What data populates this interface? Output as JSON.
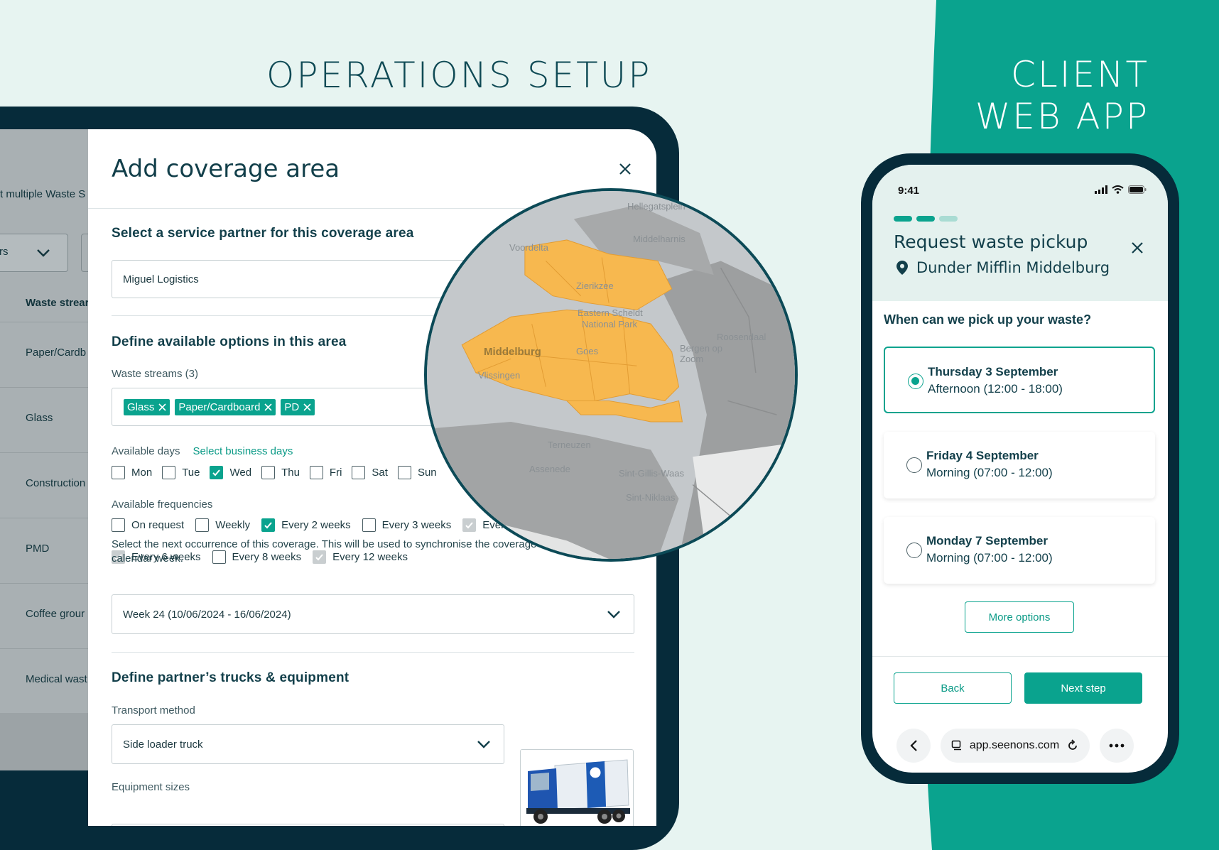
{
  "colors": {
    "accent": "#0aa38e",
    "dark": "#062b3a",
    "mint_bg": "#e7f4f1",
    "map_area": "#f7b84f"
  },
  "headings": {
    "operations": "OPERATIONS SETUP",
    "client_line1": "CLIENT",
    "client_line2": "WEB APP"
  },
  "backdrop": {
    "partial_text": "t multiple Waste S",
    "select_partial": "rs",
    "column_header": "Waste strear",
    "rows": [
      "Paper/Cardb",
      "Glass",
      "Construction",
      "PMD",
      "Coffee grour",
      "Medical wast"
    ]
  },
  "modal": {
    "title": "Add coverage area",
    "partner_section": "Select a service partner for this coverage area",
    "partner_value": "Miguel Logistics",
    "options_section": "Define available options in this area",
    "waste_label": "Waste streams (3)",
    "waste_tags": [
      "Glass",
      "Paper/Cardboard",
      "PD"
    ],
    "days_label": "Available days",
    "days_link": "Select business days",
    "days": [
      {
        "label": "Mon",
        "state": "off"
      },
      {
        "label": "Tue",
        "state": "off"
      },
      {
        "label": "Wed",
        "state": "on"
      },
      {
        "label": "Thu",
        "state": "off"
      },
      {
        "label": "Fri",
        "state": "off"
      },
      {
        "label": "Sat",
        "state": "off"
      },
      {
        "label": "Sun",
        "state": "off"
      }
    ],
    "freq_label": "Available frequencies",
    "freq_row1": [
      {
        "label": "On request",
        "state": "off"
      },
      {
        "label": "Weekly",
        "state": "off"
      },
      {
        "label": "Every 2 weeks",
        "state": "on"
      },
      {
        "label": "Every 3 weeks",
        "state": "off"
      },
      {
        "label": "Ever",
        "state": "dis"
      }
    ],
    "freq_row2": [
      {
        "label": "Every 6 weeks",
        "state": "dis"
      },
      {
        "label": "Every 8 weeks",
        "state": "off"
      },
      {
        "label": "Every 12 weeks",
        "state": "dis"
      }
    ],
    "occurrence_note": "Select the next occurrence of this coverage. This will be used to synchronise the coverage with the right calendar week.",
    "week_value": "Week 24 (10/06/2024 - 16/06/2024)",
    "trucks_section": "Define partner’s trucks & equipment",
    "transport_label": "Transport method",
    "transport_value": "Side loader truck",
    "equipment_label": "Equipment sizes"
  },
  "map": {
    "labels": [
      "Hellegatsplein",
      "Voordelta",
      "Middelharnis",
      "Zierikzee",
      "Eastern Scheldt",
      "National Park",
      "Roosendaal",
      "Middelburg",
      "Goes",
      "Bergen op Zoom",
      "Vlissingen",
      "Terneuzen",
      "Assenede",
      "Sint-Gillis-Waas",
      "Sint-Niklaas"
    ]
  },
  "phone": {
    "time": "9:41",
    "title": "Request waste pickup",
    "location": "Dunder Mifflin Middelburg",
    "question": "When can we pick up your waste?",
    "options": [
      {
        "day": "Thursday 3 September",
        "slot": "Afternoon (12:00 - 18:00)",
        "selected": true
      },
      {
        "day": "Friday 4 September",
        "slot": "Morning (07:00 - 12:00)",
        "selected": false
      },
      {
        "day": "Monday  7 September",
        "slot": "Morning (07:00 - 12:00)",
        "selected": false
      }
    ],
    "more_options": "More options",
    "back": "Back",
    "next": "Next step",
    "url": "app.seenons.com"
  }
}
